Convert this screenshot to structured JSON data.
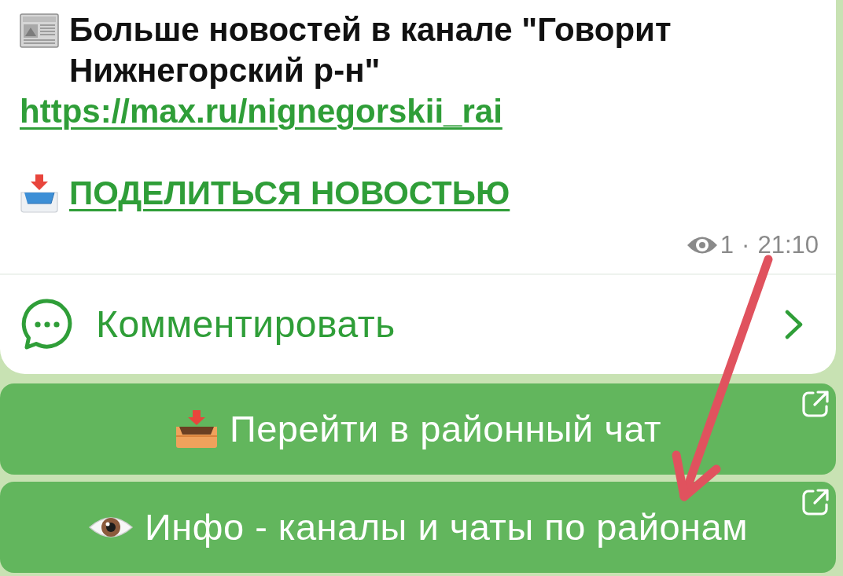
{
  "message": {
    "title": "Больше новостей в канале \"Говорит Нижнегорский р-н\"",
    "link": "https://max.ru/nignegorskii_rai",
    "share_link": "ПОДЕЛИТЬСЯ НОВОСТЬЮ",
    "views": "1",
    "separator": "·",
    "time": "21:10",
    "comment_button": "Комментировать"
  },
  "buttons": [
    {
      "label": "Перейти в районный чат"
    },
    {
      "label": "Инфо - каналы и чаты по районам"
    }
  ]
}
